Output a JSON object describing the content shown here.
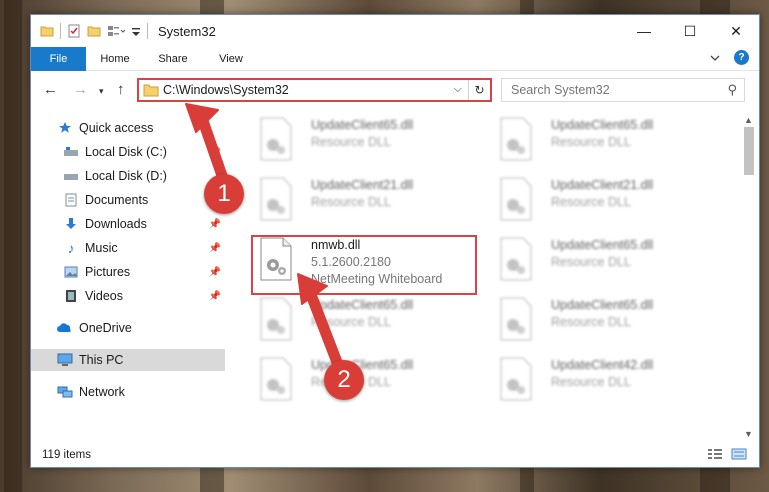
{
  "window": {
    "title": "System32",
    "controls": {
      "minimize": "—",
      "maximize": "☐",
      "close": "✕"
    }
  },
  "ribbon": {
    "tabs": [
      {
        "label": "File",
        "active": true
      },
      {
        "label": "Home"
      },
      {
        "label": "Share"
      },
      {
        "label": "View"
      }
    ]
  },
  "navigation": {
    "address": "C:\\Windows\\System32",
    "search_placeholder": "Search System32"
  },
  "sidebar": {
    "items": [
      {
        "label": "Quick access",
        "icon": "star-icon"
      },
      {
        "label": "Local Disk (C:)",
        "icon": "drive-icon"
      },
      {
        "label": "Local Disk (D:)",
        "icon": "drive-icon"
      },
      {
        "label": "Documents",
        "icon": "documents-icon"
      },
      {
        "label": "Downloads",
        "icon": "downloads-icon"
      },
      {
        "label": "Music",
        "icon": "music-icon"
      },
      {
        "label": "Pictures",
        "icon": "pictures-icon"
      },
      {
        "label": "Videos",
        "icon": "videos-icon"
      },
      {
        "label": "OneDrive",
        "icon": "cloud-icon"
      },
      {
        "label": "This PC",
        "icon": "computer-icon",
        "selected": true
      },
      {
        "label": "Network",
        "icon": "network-icon"
      }
    ]
  },
  "files": [
    {
      "name": "UpdateClient65.dll",
      "line2": "Resource DLL"
    },
    {
      "name": "UpdateClient65.dll",
      "line2": "Resource DLL"
    },
    {
      "name": "UpdateClient21.dll",
      "line2": "Resource DLL"
    },
    {
      "name": "UpdateClient21.dll",
      "line2": "Resource DLL"
    },
    {
      "name": "nmwb.dll",
      "line2": "5.1.2600.2180",
      "line3": "NetMeeting Whiteboard"
    },
    {
      "name": "UpdateClient65.dll",
      "line2": "Resource DLL"
    },
    {
      "name": "UpdateClient65.dll",
      "line2": "Resource DLL"
    },
    {
      "name": "UpdateClient65.dll",
      "line2": "Resource DLL"
    },
    {
      "name": "UpdateClient65.dll",
      "line2": "Resource DLL"
    },
    {
      "name": "UpdateClient42.dll",
      "line2": "Resource DLL"
    }
  ],
  "status": {
    "item_count": "119 items"
  },
  "annotations": {
    "step1": "1",
    "step2": "2",
    "color": "#d93d38"
  }
}
